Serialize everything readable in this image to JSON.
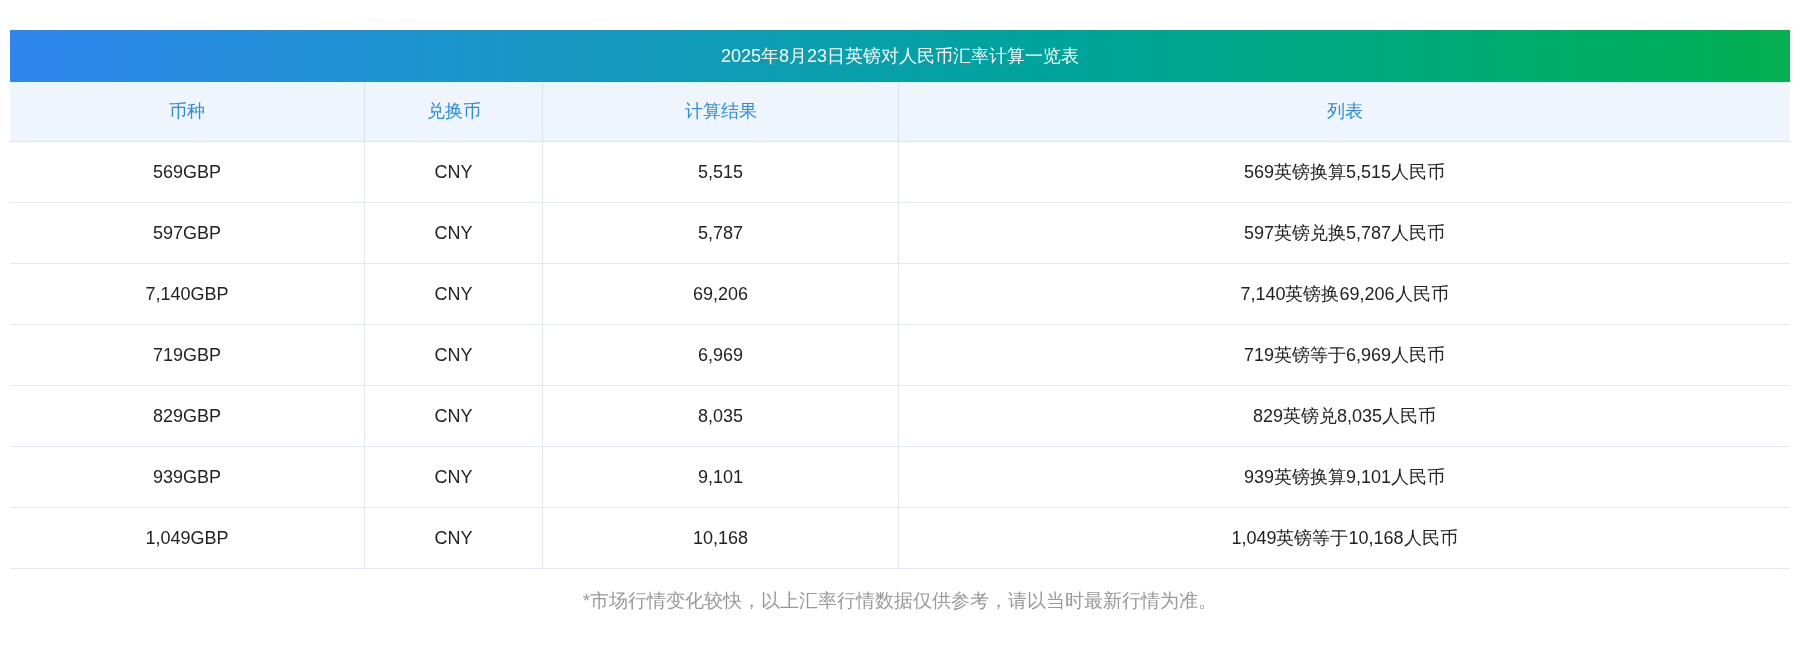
{
  "title": "2025年8月23日英镑对人民币汇率计算一览表",
  "table": {
    "columns": [
      "币种",
      "兑换币",
      "计算结果",
      "列表"
    ],
    "rows": [
      [
        "569GBP",
        "CNY",
        "5,515",
        "569英镑换算5,515人民币"
      ],
      [
        "597GBP",
        "CNY",
        "5,787",
        "597英镑兑换5,787人民币"
      ],
      [
        "7,140GBP",
        "CNY",
        "69,206",
        "7,140英镑换69,206人民币"
      ],
      [
        "719GBP",
        "CNY",
        "6,969",
        "719英镑等于6,969人民币"
      ],
      [
        "829GBP",
        "CNY",
        "8,035",
        "829英镑兑8,035人民币"
      ],
      [
        "939GBP",
        "CNY",
        "9,101",
        "939英镑换算9,101人民币"
      ],
      [
        "1,049GBP",
        "CNY",
        "10,168",
        "1,049英镑等于10,168人民币"
      ]
    ]
  },
  "footnote": "*市场行情变化较快，以上汇率行情数据仅供参考，请以当时最新行情为准。"
}
